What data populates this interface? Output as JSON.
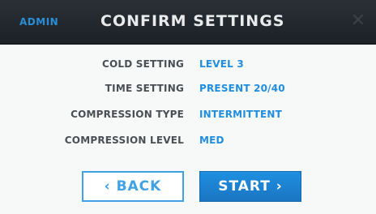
{
  "header": {
    "mode_label": "ADMIN",
    "title": "CONFIRM SETTINGS",
    "close_icon": "close-icon"
  },
  "settings": [
    {
      "label": "COLD SETTING",
      "value": "LEVEL 3"
    },
    {
      "label": "TIME SETTING",
      "value": "PRESENT 20/40"
    },
    {
      "label": "COMPRESSION TYPE",
      "value": "INTERMITTENT"
    },
    {
      "label": "COMPRESSION LEVEL",
      "value": "MED"
    }
  ],
  "buttons": {
    "back_label": "‹ BACK",
    "start_label": "START ›"
  },
  "colors": {
    "accent": "#1f8de0",
    "header_bg": "#22282e",
    "label_text": "#4a4f55"
  }
}
